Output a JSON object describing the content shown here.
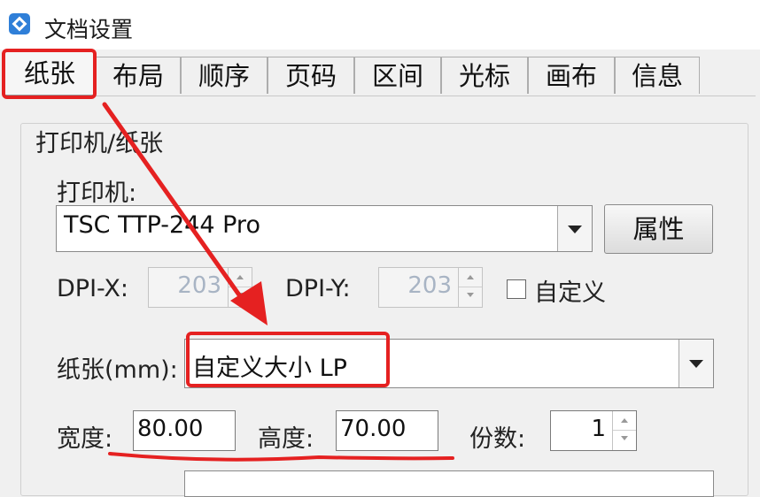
{
  "window": {
    "title": "文档设置",
    "icon": "app-logo-icon"
  },
  "tabs": [
    {
      "label": "纸张",
      "active": true
    },
    {
      "label": "布局"
    },
    {
      "label": "顺序"
    },
    {
      "label": "页码"
    },
    {
      "label": "区间"
    },
    {
      "label": "光标"
    },
    {
      "label": "画布"
    },
    {
      "label": "信息"
    }
  ],
  "group": {
    "label": "打印机/纸张"
  },
  "printer": {
    "label": "打印机:",
    "value": "TSC TTP-244 Pro",
    "properties_button": "属性"
  },
  "dpi": {
    "x_label": "DPI-X:",
    "x_value": "203",
    "y_label": "DPI-Y:",
    "y_value": "203",
    "custom_label": "自定义",
    "custom_checked": false
  },
  "paper": {
    "label": "纸张(mm):",
    "value": "自定义大小 LP"
  },
  "size": {
    "width_label": "宽度:",
    "width_value": "80.00",
    "height_label": "高度:",
    "height_value": "70.00",
    "copies_label": "份数:",
    "copies_value": "1"
  },
  "annotation_color": "#e52121"
}
